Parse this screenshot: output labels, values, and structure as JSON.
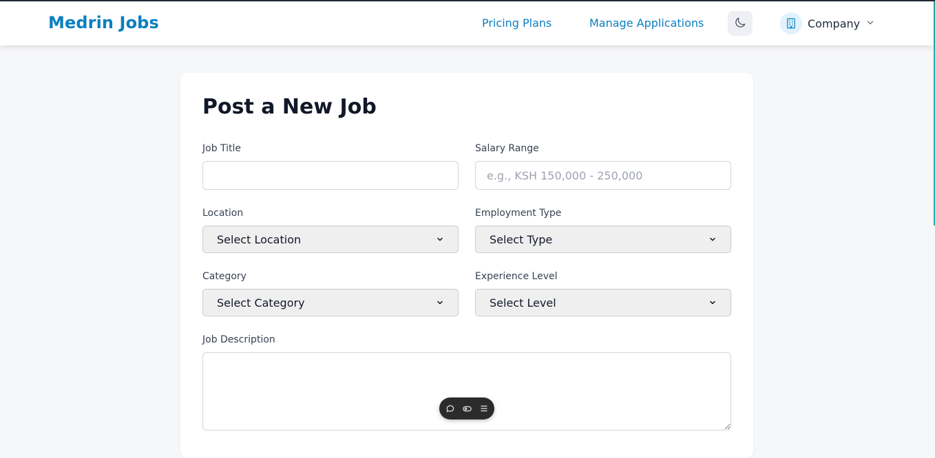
{
  "header": {
    "brand": "Medrin Jobs",
    "nav": {
      "pricing": "Pricing Plans",
      "manage": "Manage Applications"
    },
    "theme_icon": "moon-icon",
    "company_icon": "building-icon",
    "company_label": "Company"
  },
  "form": {
    "title": "Post a New Job",
    "job_title": {
      "label": "Job Title",
      "value": "",
      "placeholder": ""
    },
    "salary": {
      "label": "Salary Range",
      "value": "",
      "placeholder": "e.g., KSH 150,000 - 250,000"
    },
    "location": {
      "label": "Location",
      "selected": "Select Location"
    },
    "employment_type": {
      "label": "Employment Type",
      "selected": "Select Type"
    },
    "category": {
      "label": "Category",
      "selected": "Select Category"
    },
    "experience": {
      "label": "Experience Level",
      "selected": "Select Level"
    },
    "description": {
      "label": "Job Description",
      "value": ""
    }
  },
  "floating_toolbar": {
    "icons": [
      "comment-icon",
      "eye-icon",
      "menu-icon"
    ]
  },
  "colors": {
    "brand": "#0a7fc1",
    "page_bg": "#f6f7f9",
    "select_bg": "#efefef"
  }
}
